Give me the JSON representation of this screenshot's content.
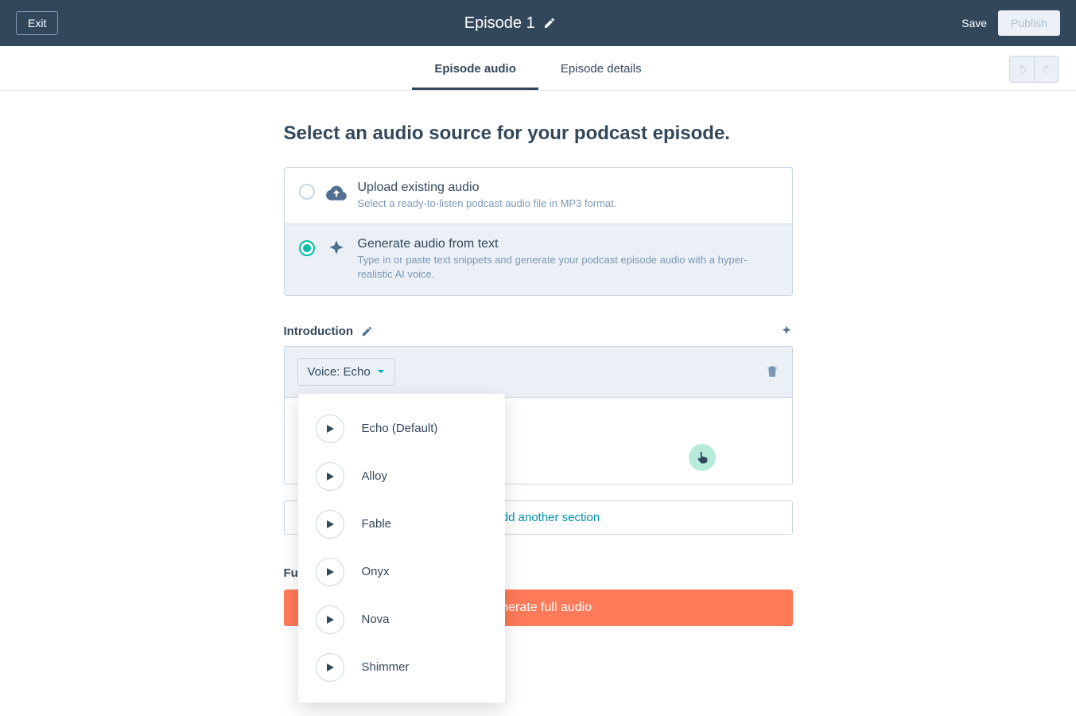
{
  "header": {
    "exit": "Exit",
    "title": "Episode 1",
    "save": "Save",
    "publish": "Publish"
  },
  "tabs": {
    "audio": "Episode audio",
    "details": "Episode details"
  },
  "page_heading": "Select an audio source for your podcast episode.",
  "sources": {
    "upload": {
      "title": "Upload existing audio",
      "desc": "Select a ready-to-listen podcast audio file in MP3 format."
    },
    "generate": {
      "title": "Generate audio from text",
      "desc": "Type in or paste text snippets and generate your podcast episode audio with a hyper-realistic AI voice."
    }
  },
  "intro": {
    "label": "Introduction",
    "voice_label": "Voice: Echo"
  },
  "voice_options": [
    {
      "label": "Echo (Default)"
    },
    {
      "label": "Alloy"
    },
    {
      "label": "Fable"
    },
    {
      "label": "Onyx"
    },
    {
      "label": "Nova"
    },
    {
      "label": "Shimmer"
    }
  ],
  "add_section": "Add another section",
  "full_episode_label": "Full episode",
  "generate_button": "Generate full audio",
  "full_episode_label_truncated": "Fu",
  "add_section_truncated": "ld another section",
  "generate_button_truncated": "enerate full audio"
}
